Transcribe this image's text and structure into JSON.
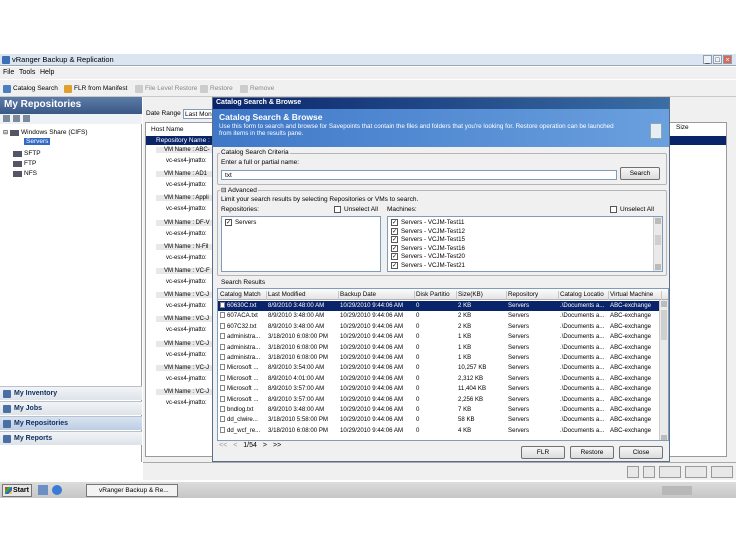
{
  "window": {
    "title": "vRanger Backup & Replication"
  },
  "menu": [
    "File",
    "Tools",
    "Help"
  ],
  "toolbar": {
    "catalog_search": "Catalog Search",
    "flr_manifest": "FLR from Manifest",
    "file_level_restore": "File Level Restore",
    "restore": "Restore",
    "remove": "Remove"
  },
  "left_pane": {
    "title": "My Repositories",
    "tree": [
      {
        "label": "Windows Share (CIFS)"
      },
      {
        "label": "Servers"
      },
      {
        "label": "SFTP"
      },
      {
        "label": "FTP"
      },
      {
        "label": "NFS"
      }
    ],
    "nav": [
      "My Inventory",
      "My Jobs",
      "My Repositories",
      "My Reports"
    ]
  },
  "main": {
    "date_range_label": "Date Range",
    "date_range_value": "Last Mon",
    "host_name_header": "Host Name",
    "size_header": "Size",
    "repo_row": "Repository Name : ...",
    "vm_groups": [
      {
        "head": "VM Name : ABC-",
        "item": "vc-esx4-jmatto:"
      },
      {
        "head": "VM Name : AD1",
        "item": "vc-esx4-jmatto:"
      },
      {
        "head": "VM Name : Appli",
        "item": "vc-esx4-jmatto:"
      },
      {
        "head": "VM Name : DF-V",
        "item": "vc-esx4-jmatto:"
      },
      {
        "head": "VM Name : N-Fil",
        "item": "vc-esx4-jmatto:"
      },
      {
        "head": "VM Name : VC-F",
        "item": "vc-esx4-jmatto:"
      },
      {
        "head": "VM Name : VC-J",
        "item": "vc-esx4-jmatto:"
      },
      {
        "head": "VM Name : VC-J",
        "item": "vc-esx4-jmatto:"
      },
      {
        "head": "VM Name : VC-J",
        "item": "vc-esx4-jmatto:"
      },
      {
        "head": "VM Name : VC-J",
        "item": "vc-esx4-jmatto:"
      },
      {
        "head": "VM Name : VC-J",
        "item": "vc-esx4-jmatto:"
      }
    ]
  },
  "dialog": {
    "title": "Catalog Search & Browse",
    "banner_title": "Catalog Search & Browse",
    "banner_desc": "Use this form to search and browse for Savepoints that contain the files and folders that you're looking for. Restore operation can be launched from items in the results pane.",
    "criteria_label": "Catalog Search Criteria",
    "enter_label": "Enter a full or partial name:",
    "search_value": "txt",
    "search_button": "Search",
    "advanced_label": "Advanced",
    "limit_text": "Limit your search results by selecting Repositories or VMs to search.",
    "repositories_label": "Repositories:",
    "unselect_all": "Unselect All",
    "machines_label": "Machines:",
    "repositories": [
      "Servers"
    ],
    "machines": [
      "Servers - VCJM-Test11",
      "Servers - VCJM-Test12",
      "Servers - VCJM-Test15",
      "Servers - VCJM-Test16",
      "Servers - VCJM-Test20",
      "Servers - VCJM-Test21"
    ],
    "results_label": "Search Results",
    "columns": [
      "Catalog Match",
      "Last Modified",
      "Backup Date",
      "Disk Partitio",
      "Size(KB)",
      "Repository",
      "Catalog Locatio",
      "Virtual Machine"
    ],
    "rows": [
      [
        "60630C.txt",
        "8/9/2010 3:48:00 AM",
        "10/29/2010 9:44:06 AM",
        "0",
        "2 KB",
        "Servers",
        ".\\Documents a...",
        "ABC-exchange"
      ],
      [
        "607ACA.txt",
        "8/9/2010 3:48:00 AM",
        "10/29/2010 9:44:06 AM",
        "0",
        "2 KB",
        "Servers",
        ".\\Documents a...",
        "ABC-exchange"
      ],
      [
        "607C32.txt",
        "8/9/2010 3:48:00 AM",
        "10/29/2010 9:44:06 AM",
        "0",
        "2 KB",
        "Servers",
        ".\\Documents a...",
        "ABC-exchange"
      ],
      [
        "administra...",
        "3/18/2010 6:08:00 PM",
        "10/29/2010 9:44:06 AM",
        "0",
        "1 KB",
        "Servers",
        ".\\Documents a...",
        "ABC-exchange"
      ],
      [
        "administra...",
        "3/18/2010 6:08:00 PM",
        "10/29/2010 9:44:06 AM",
        "0",
        "1 KB",
        "Servers",
        ".\\Documents a...",
        "ABC-exchange"
      ],
      [
        "administra...",
        "3/18/2010 6:08:00 PM",
        "10/29/2010 9:44:06 AM",
        "0",
        "1 KB",
        "Servers",
        ".\\Documents a...",
        "ABC-exchange"
      ],
      [
        "Microsoft ...",
        "8/9/2010 3:54:00 AM",
        "10/29/2010 9:44:06 AM",
        "0",
        "10,257 KB",
        "Servers",
        ".\\Documents a...",
        "ABC-exchange"
      ],
      [
        "Microsoft ...",
        "8/9/2010 4:01:00 AM",
        "10/29/2010 9:44:06 AM",
        "0",
        "2,312 KB",
        "Servers",
        ".\\Documents a...",
        "ABC-exchange"
      ],
      [
        "Microsoft ...",
        "8/9/2010 3:57:00 AM",
        "10/29/2010 9:44:06 AM",
        "0",
        "11,404 KB",
        "Servers",
        ".\\Documents a...",
        "ABC-exchange"
      ],
      [
        "Microsoft ...",
        "8/9/2010 3:57:00 AM",
        "10/29/2010 9:44:06 AM",
        "0",
        "2,256 KB",
        "Servers",
        ".\\Documents a...",
        "ABC-exchange"
      ],
      [
        "bndlog.txt",
        "8/9/2010 3:48:00 AM",
        "10/29/2010 9:44:06 AM",
        "0",
        "7 KB",
        "Servers",
        ".\\Documents a...",
        "ABC-exchange"
      ],
      [
        "dd_clwire...",
        "3/18/2010 5:58:00 PM",
        "10/29/2010 9:44:06 AM",
        "0",
        "58 KB",
        "Servers",
        ".\\Documents a...",
        "ABC-exchange"
      ],
      [
        "dd_wcf_re...",
        "3/18/2010 6:08:00 PM",
        "10/29/2010 9:44:06 AM",
        "0",
        "4 KB",
        "Servers",
        ".\\Documents a...",
        "ABC-exchange"
      ]
    ],
    "pager": {
      "first": "<<",
      "prev": "<",
      "page": "1/54",
      "next": ">",
      "last": ">>"
    },
    "flr_button": "FLR",
    "restore_button": "Restore",
    "close_button": "Close"
  },
  "taskbar": {
    "start": "Start",
    "item": "vRanger Backup & Re..."
  }
}
